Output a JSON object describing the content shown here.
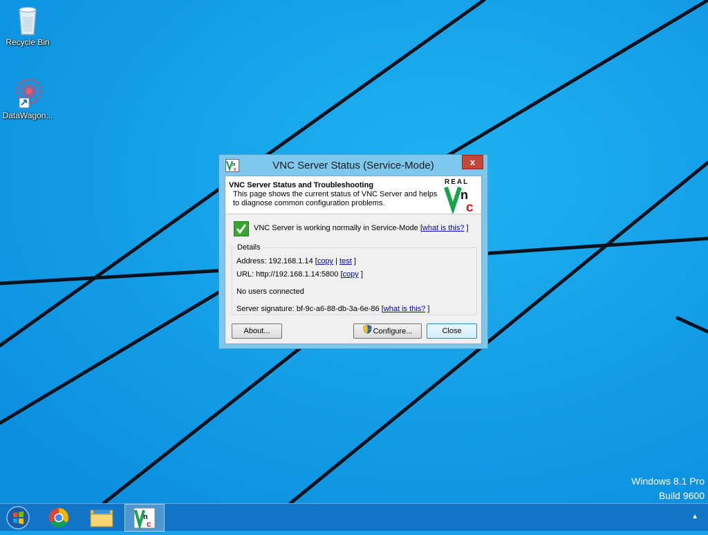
{
  "desktop": {
    "icons": [
      {
        "label": "Recycle Bin",
        "icon": "recycle-bin-icon"
      },
      {
        "label": "DataWagon...",
        "icon": "datawagon-icon"
      }
    ],
    "watermark": {
      "line1": "Windows 8.1 Pro",
      "line2": "Build 9600"
    }
  },
  "dialog": {
    "title": "VNC Server Status (Service-Mode)",
    "close_glyph": "x",
    "header": {
      "title": "VNC Server Status and Troubleshooting",
      "description": "This page shows the current status of VNC Server and helps to diagnose common configuration problems."
    },
    "logo": {
      "word": "REAL",
      "letters": "VNC"
    },
    "status": {
      "text": "VNC Server is working normally in Service-Mode [",
      "link": "what is this?",
      "close": " ]"
    },
    "details": {
      "legend": "Details",
      "address_prefix": "Address: 192.168.1.14 [",
      "address_copy": "copy",
      "address_sep": " | ",
      "address_test": "test",
      "address_close": " ]",
      "url_prefix": "URL: http://192.168.1.14:5800 [",
      "url_copy": "copy",
      "url_close": " ]",
      "users": "No users connected",
      "sig_prefix": "Server signature: bf-9c-a6-88-db-3a-6e-86 [",
      "sig_link": "what is this?",
      "sig_close": " ]"
    },
    "buttons": {
      "about": "About...",
      "configure": "Configure...",
      "close": "Close"
    }
  },
  "taskbar": {
    "items": [
      "start",
      "chrome",
      "file-explorer",
      "vnc-server"
    ],
    "tray_glyph": "▲"
  },
  "colors": {
    "wallpaper": "#1aa0e8",
    "taskbar": "#1274c4",
    "dialog_frame": "#7ec8ee",
    "close_button": "#c7463a",
    "link": "#0000c0",
    "status_ok": "#3aa531"
  }
}
